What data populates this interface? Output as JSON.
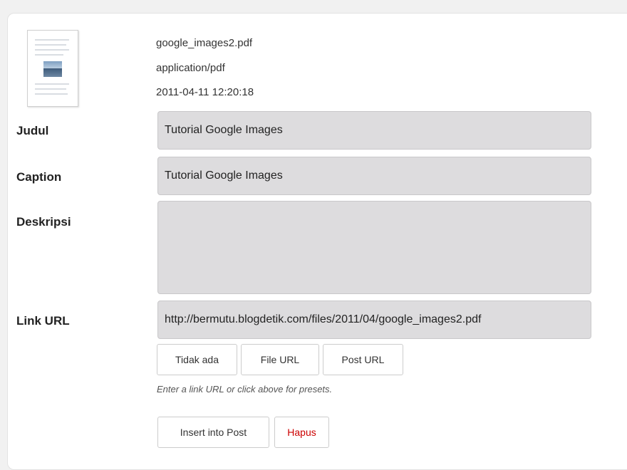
{
  "file": {
    "name": "google_images2.pdf",
    "mime": "application/pdf",
    "date": "2011-04-11 12:20:18"
  },
  "fields": {
    "judul": {
      "label": "Judul",
      "value": "Tutorial Google Images"
    },
    "caption": {
      "label": "Caption",
      "value": "Tutorial Google Images"
    },
    "deskripsi": {
      "label": "Deskripsi",
      "value": ""
    },
    "link_url": {
      "label": "Link URL",
      "value": "http://bermutu.blogdetik.com/files/2011/04/google_images2.pdf"
    }
  },
  "link_buttons": {
    "none": "Tidak ada",
    "file_url": "File URL",
    "post_url": "Post URL"
  },
  "link_hint": "Enter a link URL or click above for presets.",
  "actions": {
    "insert": "Insert into Post",
    "delete": "Hapus"
  },
  "colors": {
    "field_bg": "#dddcde",
    "delete_text": "#cc0000"
  }
}
